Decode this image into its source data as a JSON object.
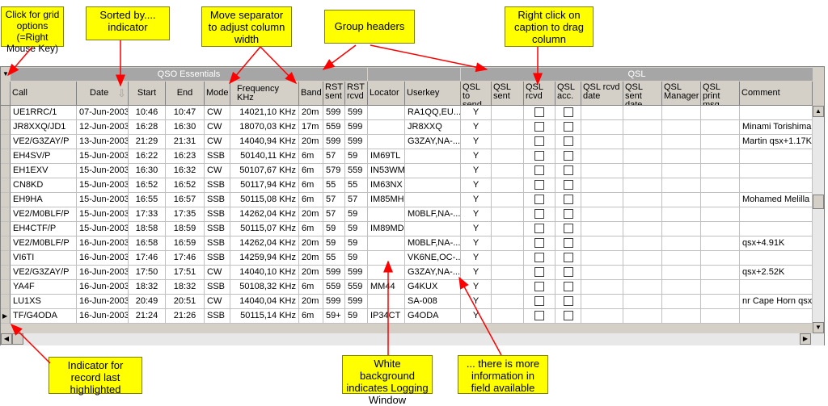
{
  "callouts": {
    "grid_options": "Click for grid options (=Right Mouse Key)",
    "sorted_by": "Sorted by.... indicator",
    "move_separator": "Move separator to adjust column width",
    "group_headers": "Group headers",
    "right_click_caption": "Right click on caption to drag column",
    "indicator_last": "Indicator for record last highlighted",
    "white_background": "White background indicates Logging Window",
    "more_info": "... there is more information in field available"
  },
  "groups": {
    "qso": "QSO Essentials",
    "qsl": "QSL"
  },
  "columns": [
    {
      "key": "call",
      "label": "Call"
    },
    {
      "key": "date",
      "label": "Date"
    },
    {
      "key": "start",
      "label": "Start"
    },
    {
      "key": "end",
      "label": "End"
    },
    {
      "key": "mode",
      "label": "Mode"
    },
    {
      "key": "freq",
      "label": "Frequency KHz"
    },
    {
      "key": "band",
      "label": "Band"
    },
    {
      "key": "rst_sent",
      "label": "RST sent"
    },
    {
      "key": "rst_rcvd",
      "label": "RST rcvd"
    },
    {
      "key": "locator",
      "label": "Locator"
    },
    {
      "key": "userkey",
      "label": "Userkey"
    },
    {
      "key": "qsl_to_send",
      "label": "QSL to send"
    },
    {
      "key": "qsl_sent",
      "label": "QSL sent"
    },
    {
      "key": "qsl_rcvd",
      "label": "QSL rcvd"
    },
    {
      "key": "qsl_acc",
      "label": "QSL acc."
    },
    {
      "key": "qsl_rcvd_date",
      "label": "QSL rcvd date"
    },
    {
      "key": "qsl_sent_date",
      "label": "QSL sent date"
    },
    {
      "key": "qsl_manager",
      "label": "QSL Manager"
    },
    {
      "key": "qsl_print_msg",
      "label": "QSL print msg."
    },
    {
      "key": "comment",
      "label": "Comment"
    }
  ],
  "rows": [
    {
      "call": "UE1RRC/1",
      "date": "07-Jun-2003",
      "start": "10:46",
      "end": "10:47",
      "mode": "CW",
      "freq": "14021,10 KHz",
      "band": "20m",
      "rst_sent": "599",
      "rst_rcvd": "599",
      "locator": "",
      "userkey": "RA1QQ,EU...",
      "qsl_to_send": "Y",
      "comment": ""
    },
    {
      "call": "JR8XXQ/JD1",
      "date": "12-Jun-2003",
      "start": "16:28",
      "end": "16:30",
      "mode": "CW",
      "freq": "18070,03 KHz",
      "band": "17m",
      "rst_sent": "559",
      "rst_rcvd": "599",
      "locator": "",
      "userkey": "JR8XXQ",
      "qsl_to_send": "Y",
      "comment": "Minami Torishima ..."
    },
    {
      "call": "VE2/G3ZAY/P",
      "date": "13-Jun-2003",
      "start": "21:29",
      "end": "21:31",
      "mode": "CW",
      "freq": "14040,94 KHz",
      "band": "20m",
      "rst_sent": "599",
      "rst_rcvd": "599",
      "locator": "",
      "userkey": "G3ZAY,NA-...",
      "qsl_to_send": "Y",
      "comment": "Martin qsx+1.17K"
    },
    {
      "call": "EH4SV/P",
      "date": "15-Jun-2003",
      "start": "16:22",
      "end": "16:23",
      "mode": "SSB",
      "freq": "50140,11 KHz",
      "band": "6m",
      "rst_sent": "57",
      "rst_rcvd": "59",
      "locator": "IM69TL",
      "userkey": "",
      "qsl_to_send": "Y",
      "comment": ""
    },
    {
      "call": "EH1EXV",
      "date": "15-Jun-2003",
      "start": "16:30",
      "end": "16:32",
      "mode": "CW",
      "freq": "50107,67 KHz",
      "band": "6m",
      "rst_sent": "579",
      "rst_rcvd": "559",
      "locator": "IN53WM",
      "userkey": "",
      "qsl_to_send": "Y",
      "comment": ""
    },
    {
      "call": "CN8KD",
      "date": "15-Jun-2003",
      "start": "16:52",
      "end": "16:52",
      "mode": "SSB",
      "freq": "50117,94 KHz",
      "band": "6m",
      "rst_sent": "55",
      "rst_rcvd": "55",
      "locator": "IM63NX",
      "userkey": "",
      "qsl_to_send": "Y",
      "comment": ""
    },
    {
      "call": "EH9HA",
      "date": "15-Jun-2003",
      "start": "16:55",
      "end": "16:57",
      "mode": "SSB",
      "freq": "50115,08 KHz",
      "band": "6m",
      "rst_sent": "57",
      "rst_rcvd": "57",
      "locator": "IM85MH",
      "userkey": "",
      "qsl_to_send": "Y",
      "comment": "Mohamed Melilla"
    },
    {
      "call": "VE2/M0BLF/P",
      "date": "15-Jun-2003",
      "start": "17:33",
      "end": "17:35",
      "mode": "SSB",
      "freq": "14262,04 KHz",
      "band": "20m",
      "rst_sent": "57",
      "rst_rcvd": "59",
      "locator": "",
      "userkey": "M0BLF,NA-...",
      "qsl_to_send": "Y",
      "comment": ""
    },
    {
      "call": "EH4CTF/P",
      "date": "15-Jun-2003",
      "start": "18:58",
      "end": "18:59",
      "mode": "SSB",
      "freq": "50115,07 KHz",
      "band": "6m",
      "rst_sent": "59",
      "rst_rcvd": "59",
      "locator": "IM89MD",
      "userkey": "",
      "qsl_to_send": "Y",
      "comment": ""
    },
    {
      "call": "VE2/M0BLF/P",
      "date": "16-Jun-2003",
      "start": "16:58",
      "end": "16:59",
      "mode": "SSB",
      "freq": "14262,04 KHz",
      "band": "20m",
      "rst_sent": "59",
      "rst_rcvd": "59",
      "locator": "",
      "userkey": "M0BLF,NA-...",
      "qsl_to_send": "Y",
      "comment": "qsx+4.91K"
    },
    {
      "call": "VI6TI",
      "date": "16-Jun-2003",
      "start": "17:46",
      "end": "17:46",
      "mode": "SSB",
      "freq": "14259,94 KHz",
      "band": "20m",
      "rst_sent": "55",
      "rst_rcvd": "59",
      "locator": "",
      "userkey": "VK6NE,OC-...",
      "qsl_to_send": "Y",
      "comment": ""
    },
    {
      "call": "VE2/G3ZAY/P",
      "date": "16-Jun-2003",
      "start": "17:50",
      "end": "17:51",
      "mode": "CW",
      "freq": "14040,10 KHz",
      "band": "20m",
      "rst_sent": "599",
      "rst_rcvd": "599",
      "locator": "",
      "userkey": "G3ZAY,NA-...",
      "qsl_to_send": "Y",
      "comment": "qsx+2.52K"
    },
    {
      "call": "YA4F",
      "date": "16-Jun-2003",
      "start": "18:32",
      "end": "18:32",
      "mode": "SSB",
      "freq": "50108,32 KHz",
      "band": "6m",
      "rst_sent": "559",
      "rst_rcvd": "559",
      "locator": "MM44",
      "userkey": "G4KUX",
      "qsl_to_send": "Y",
      "comment": ""
    },
    {
      "call": "LU1XS",
      "date": "16-Jun-2003",
      "start": "20:49",
      "end": "20:51",
      "mode": "CW",
      "freq": "14040,04 KHz",
      "band": "20m",
      "rst_sent": "599",
      "rst_rcvd": "599",
      "locator": "",
      "userkey": "SA-008",
      "qsl_to_send": "Y",
      "comment": "nr Cape Horn qsx..."
    },
    {
      "call": "TF/G4ODA",
      "date": "16-Jun-2003",
      "start": "21:24",
      "end": "21:26",
      "mode": "SSB",
      "freq": "50115,14 KHz",
      "band": "6m",
      "rst_sent": "59+",
      "rst_rcvd": "59",
      "locator": "IP34CT",
      "userkey": "G4ODA",
      "qsl_to_send": "Y",
      "comment": ""
    }
  ],
  "icons": {
    "grid_options": "triangle-down-icon",
    "sort": "sort-arrow-icon",
    "current_record": "triangle-right-icon"
  },
  "colors": {
    "callout_bg": "#ffff00",
    "arrow": "#ff0000",
    "group_bar": "#a6a6a6"
  }
}
